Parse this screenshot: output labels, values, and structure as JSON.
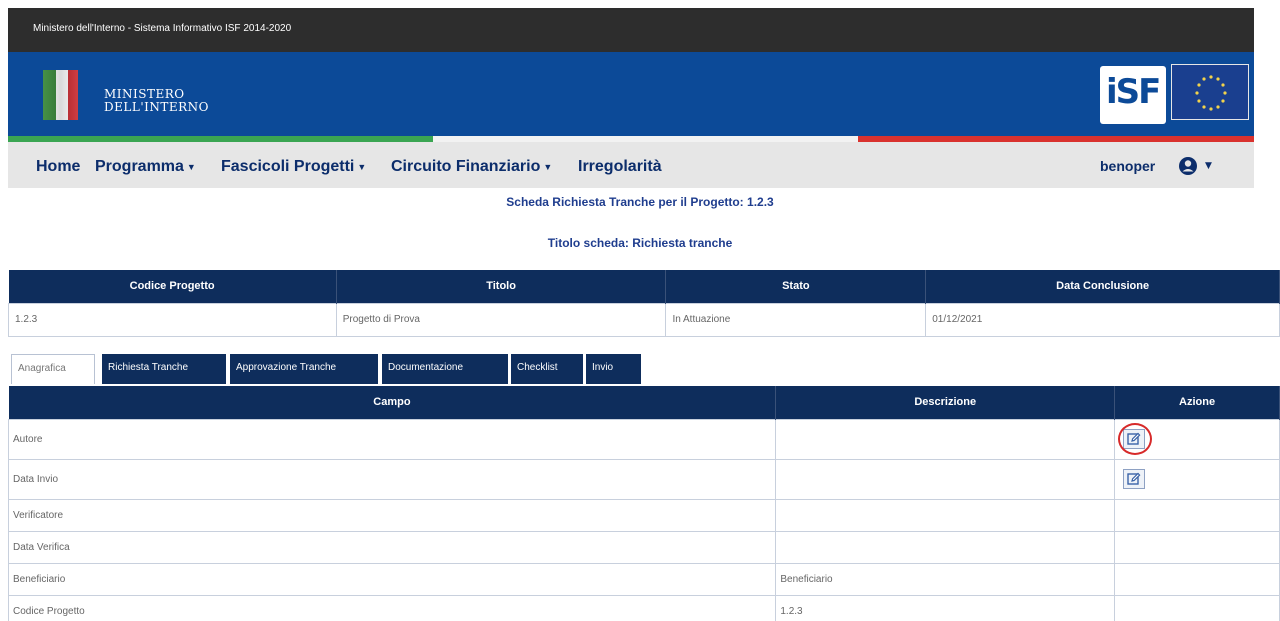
{
  "topbar": {
    "title": "Ministero dell'Interno - Sistema Informativo ISF 2014-2020"
  },
  "header": {
    "ministry_line1": "MINISTERO",
    "ministry_line2": "DELL'INTERNO",
    "isf_logo": "iSF"
  },
  "nav": {
    "home": "Home",
    "programma": "Programma",
    "fascicoli": "Fascicoli Progetti",
    "circuito": "Circuito Finanziario",
    "irregolarita": "Irregolarità",
    "user": "benoper"
  },
  "page": {
    "title": "Scheda Richiesta Tranche per il Progetto: 1.2.3",
    "subtitle": "Titolo scheda: Richiesta tranche"
  },
  "project_table": {
    "headers": [
      "Codice Progetto",
      "Titolo",
      "Stato",
      "Data Conclusione"
    ],
    "row": [
      "1.2.3",
      "Progetto di Prova",
      "In Attuazione",
      "01/12/2021"
    ]
  },
  "tabs": [
    "Anagrafica",
    "Richiesta Tranche",
    "Approvazione Tranche",
    "Documentazione",
    "Checklist",
    "Invio"
  ],
  "field_table": {
    "headers": [
      "Campo",
      "Descrizione",
      "Azione"
    ],
    "rows": [
      {
        "campo": "Autore",
        "descrizione": "",
        "edit": true
      },
      {
        "campo": "Data Invio",
        "descrizione": "",
        "edit": true
      },
      {
        "campo": "Verificatore",
        "descrizione": "",
        "edit": false
      },
      {
        "campo": "Data Verifica",
        "descrizione": "",
        "edit": false
      },
      {
        "campo": "Beneficiario",
        "descrizione": "Beneficiario",
        "edit": false
      },
      {
        "campo": "Codice Progetto",
        "descrizione": "1.2.3",
        "edit": false
      }
    ]
  },
  "colors": {
    "navy": "#0e2d5c",
    "header_blue": "#0c4a98",
    "highlight_red": "#d72a2a"
  },
  "icons": [
    "user-circle-icon",
    "caret-down-icon",
    "edit-icon"
  ]
}
